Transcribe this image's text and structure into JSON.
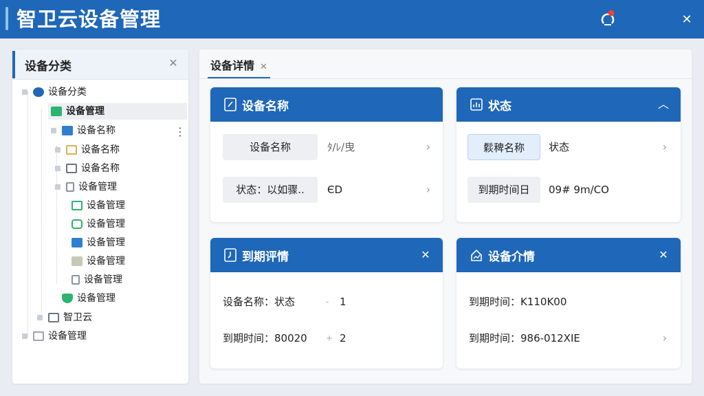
{
  "header": {
    "title": "智卫云设备管理"
  },
  "sidebar": {
    "title": "设备分类",
    "tree": [
      {
        "label": "设备分类",
        "icon": "hexagon-icon",
        "color": "#1f67b8"
      },
      {
        "label": "设备管理",
        "icon": "device-icon",
        "color": "#2db36f"
      },
      {
        "label": "设备名称",
        "icon": "folder-icon",
        "color": "#2f7fd0"
      },
      {
        "label": "设备名称",
        "icon": "window-icon",
        "color": "#d9b15a"
      },
      {
        "label": "设备名称",
        "icon": "window-icon",
        "color": "#6c7380"
      },
      {
        "label": "设备管理",
        "icon": "file-icon",
        "color": "#8a92a0"
      },
      {
        "label": "设备管理",
        "icon": "monitor-icon",
        "color": "#2db36f"
      },
      {
        "label": "设备管理",
        "icon": "refresh-icon",
        "color": "#2db36f"
      },
      {
        "label": "设备管理",
        "icon": "upload-icon",
        "color": "#2f7fd0"
      },
      {
        "label": "设备管理",
        "icon": "box-icon",
        "color": "#c7c9b8"
      },
      {
        "label": "设备管理",
        "icon": "file-icon",
        "color": "#8a92a0"
      },
      {
        "label": "设备管理",
        "icon": "shield-icon",
        "color": "#2db36f"
      },
      {
        "label": "智卫云",
        "icon": "monitor-icon",
        "color": "#6c7380"
      },
      {
        "label": "设备管理",
        "icon": "folder-icon",
        "color": "#9aa2ae"
      }
    ]
  },
  "tab": {
    "label": "设备详情"
  },
  "cards": {
    "device_name": {
      "title": "设备名称",
      "row1": {
        "label": "设备名称",
        "value": "ﾀ/ﾚ/曳"
      },
      "row2": {
        "label": "状态：以如骤..",
        "value": "ЄD"
      }
    },
    "status": {
      "title": "状态",
      "row1": {
        "label": "鬏稗名称",
        "value": "状态"
      },
      "row2": {
        "label": "到期时间日",
        "value": "09# 9m/CO"
      }
    },
    "expiry": {
      "title": "到期评情",
      "row1": {
        "text": "设备名称：状态",
        "value": "1"
      },
      "row2": {
        "text": "到期时间：80020",
        "value": "2"
      }
    },
    "detail": {
      "title": "设备介情",
      "row1": {
        "text": "到期时间：K110K00"
      },
      "row2": {
        "text": "到期时间：986-012XIE"
      }
    }
  },
  "colors": {
    "primary": "#1f67b8",
    "background": "#e9edf3"
  }
}
